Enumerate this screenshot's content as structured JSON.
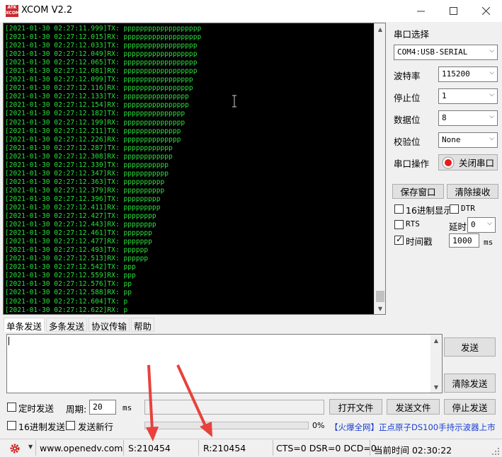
{
  "window": {
    "title": "XCOM V2.2",
    "logo_text": "ATK XCOM"
  },
  "terminal": {
    "lines": [
      "[2021-01-30 02:27:11.999]TX: ppppppppppppppppppp",
      "[2021-01-30 02:27:12.015]RX: ppppppppppppppppppp",
      "[2021-01-30 02:27:12.033]TX: pppppppppppppppppp",
      "[2021-01-30 02:27:12.049]RX: pppppppppppppppppp",
      "[2021-01-30 02:27:12.065]TX: pppppppppppppppppp",
      "[2021-01-30 02:27:12.081]RX: pppppppppppppppppp",
      "[2021-01-30 02:27:12.099]TX: ppppppppppppppppp",
      "[2021-01-30 02:27:12.116]RX: ppppppppppppppppp",
      "[2021-01-30 02:27:12.133]TX: pppppppppppppppp",
      "[2021-01-30 02:27:12.154]RX: pppppppppppppppp",
      "[2021-01-30 02:27:12.182]TX: ppppppppppppppp",
      "[2021-01-30 02:27:12.199]RX: ppppppppppppppp",
      "[2021-01-30 02:27:12.211]TX: pppppppppppppp",
      "[2021-01-30 02:27:12.226]RX: pppppppppppppp",
      "[2021-01-30 02:27:12.287]TX: pppppppppppp",
      "[2021-01-30 02:27:12.308]RX: pppppppppppp",
      "[2021-01-30 02:27:12.330]TX: ppppppppppp",
      "[2021-01-30 02:27:12.347]RX: ppppppppppp",
      "[2021-01-30 02:27:12.363]TX: pppppppppp",
      "[2021-01-30 02:27:12.379]RX: pppppppppp",
      "[2021-01-30 02:27:12.396]TX: ppppppppp",
      "[2021-01-30 02:27:12.411]RX: ppppppppp",
      "[2021-01-30 02:27:12.427]TX: pppppppp",
      "[2021-01-30 02:27:12.443]RX: pppppppp",
      "[2021-01-30 02:27:12.461]TX: ppppppp",
      "[2021-01-30 02:27:12.477]RX: ppppppp",
      "[2021-01-30 02:27:12.493]TX: pppppp",
      "[2021-01-30 02:27:12.513]RX: pppppp",
      "[2021-01-30 02:27:12.542]TX: ppp",
      "[2021-01-30 02:27:12.559]RX: ppp",
      "[2021-01-30 02:27:12.576]TX: pp",
      "[2021-01-30 02:27:12.588]RX: pp",
      "[2021-01-30 02:27:12.604]TX: p",
      "[2021-01-30 02:27:12.622]RX: p"
    ]
  },
  "panel": {
    "port_select_label": "串口选择",
    "port_value": "COM4:USB-SERIAL",
    "baud_label": "波特率",
    "baud_value": "115200",
    "stop_label": "停止位",
    "stop_value": "1",
    "data_label": "数据位",
    "data_value": "8",
    "parity_label": "校验位",
    "parity_value": "None",
    "port_op_label": "串口操作",
    "close_port_button": "关闭串口",
    "save_window_button": "保存窗口",
    "clear_recv_button": "清除接收",
    "hex_display_label": "16进制显示",
    "dtr_label": "DTR",
    "rts_label": "RTS",
    "delay_label": "延时",
    "delay_value": "0",
    "timestamp_label": "时间戳",
    "timestamp_value": "1000",
    "ms_label": "ms"
  },
  "tabs": [
    "单条发送",
    "多条发送",
    "协议传输",
    "帮助"
  ],
  "send": {
    "send_button": "发送",
    "clear_send_button": "清除发送",
    "timed_send_label": "定时发送",
    "period_label": "周期:",
    "period_value": "20",
    "period_unit": "ms",
    "open_file_button": "打开文件",
    "send_file_button": "发送文件",
    "stop_send_button": "停止发送",
    "hex_send_label": "16进制发送",
    "newline_label": "发送新行",
    "progress_percent": "0%",
    "progress_fraction": 0,
    "ad_text": "【火爆全网】正点原子DS100手持示波器上市"
  },
  "status": {
    "website": "www.openedv.com",
    "sent": "S:210454",
    "received": "R:210454",
    "signals": "CTS=0 DSR=0 DCD=0",
    "time": "当前时间 02:30:22"
  },
  "colors": {
    "terminal_text": "#29e23b",
    "terminal_bg": "#000000",
    "ad_text": "#1a3fd0",
    "annotation_arrow": "#e8413c"
  }
}
